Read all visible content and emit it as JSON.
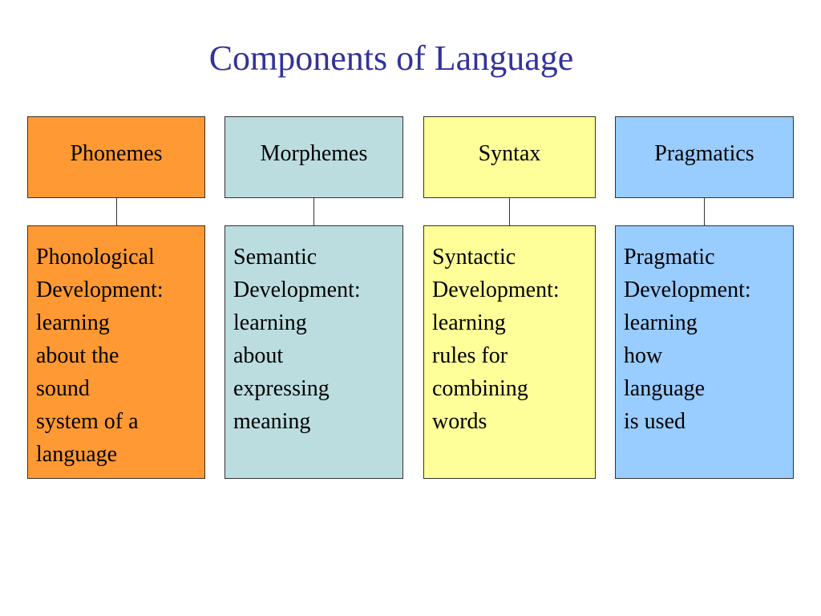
{
  "title": "Components of Language",
  "colors": {
    "title": "#333399",
    "phonemes": "#FF9933",
    "morphemes": "#BBDDE0",
    "syntax": "#FFFF99",
    "pragmatics": "#99CCFF",
    "border": "#333333"
  },
  "components": [
    {
      "heading": "Phonemes",
      "description": "Phonological\nDevelopment:\nlearning\nabout the\nsound\nsystem of a\nlanguage"
    },
    {
      "heading": "Morphemes",
      "description": "Semantic\nDevelopment:\nlearning\nabout\nexpressing\nmeaning"
    },
    {
      "heading": "Syntax",
      "description": "Syntactic\nDevelopment:\nlearning\nrules for\ncombining\nwords"
    },
    {
      "heading": "Pragmatics",
      "description": "Pragmatic\nDevelopment:\nlearning\nhow\nlanguage\nis used"
    }
  ]
}
